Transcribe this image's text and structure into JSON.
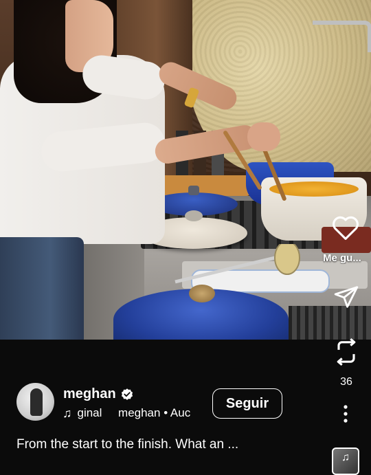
{
  "post": {
    "username": "meghan",
    "verified_icon": "verified-badge-icon",
    "audio_text": "ginal     meghan • Auc",
    "follow_label": "Seguir",
    "caption": "From the start to the finish. What an ..."
  },
  "actions": {
    "like_icon": "heart-outline-icon",
    "like_label": "Me gu...",
    "share_icon": "paper-plane-icon",
    "repost_icon": "repost-icon",
    "repost_count": "36",
    "more_icon": "vertical-ellipsis-icon",
    "audio_icon": "music-note-icon"
  },
  "colors": {
    "background": "#0b0b0b",
    "text": "#ffffff"
  }
}
